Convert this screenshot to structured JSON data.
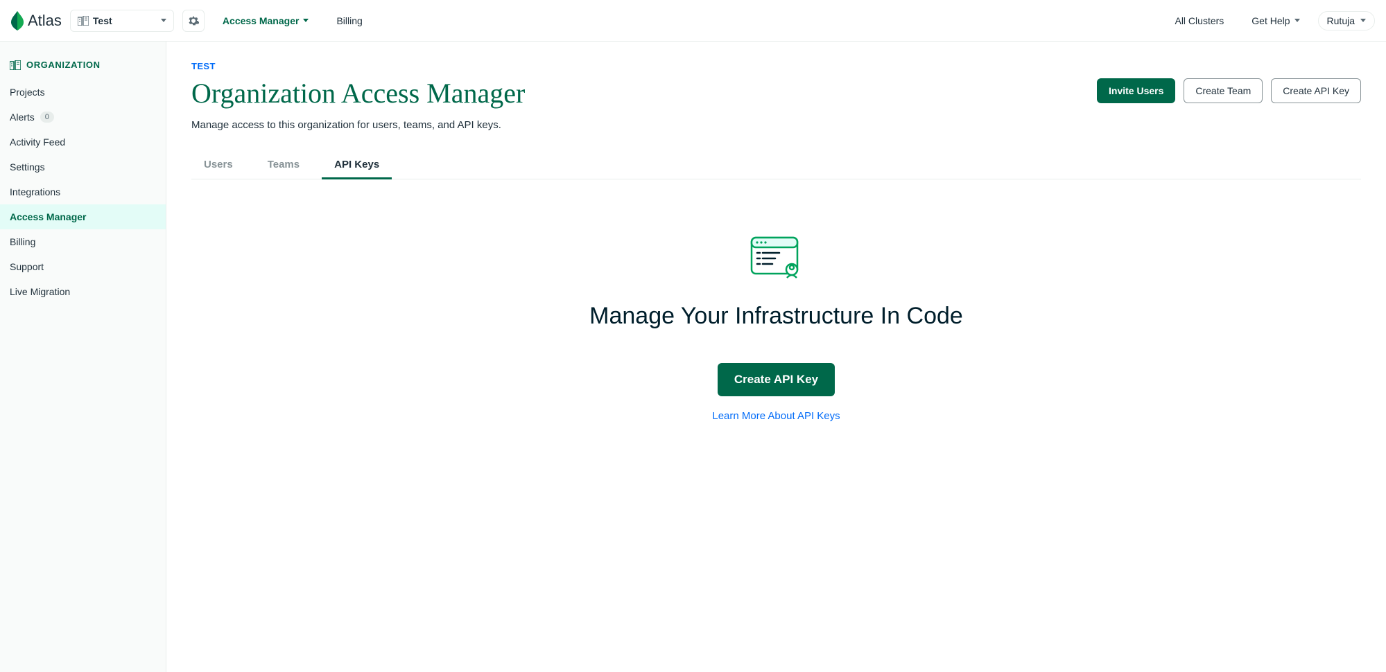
{
  "brand": "Atlas",
  "topnav": {
    "org_selector": "Test",
    "access_manager": "Access Manager",
    "billing": "Billing",
    "all_clusters": "All Clusters",
    "get_help": "Get Help",
    "user": "Rutuja"
  },
  "sidebar": {
    "header": "ORGANIZATION",
    "items": [
      {
        "label": "Projects"
      },
      {
        "label": "Alerts",
        "badge": "0"
      },
      {
        "label": "Activity Feed"
      },
      {
        "label": "Settings"
      },
      {
        "label": "Integrations"
      },
      {
        "label": "Access Manager",
        "active": true
      },
      {
        "label": "Billing"
      },
      {
        "label": "Support"
      },
      {
        "label": "Live Migration"
      }
    ]
  },
  "main": {
    "breadcrumb": "TEST",
    "title": "Organization Access Manager",
    "description": "Manage access to this organization for users, teams, and API keys.",
    "actions": {
      "invite": "Invite Users",
      "create_team": "Create Team",
      "create_api_key": "Create API Key"
    },
    "tabs": [
      {
        "label": "Users"
      },
      {
        "label": "Teams"
      },
      {
        "label": "API Keys",
        "active": true
      }
    ],
    "empty": {
      "heading": "Manage Your Infrastructure In Code",
      "cta": "Create API Key",
      "learn_more": "Learn More About API Keys"
    }
  }
}
